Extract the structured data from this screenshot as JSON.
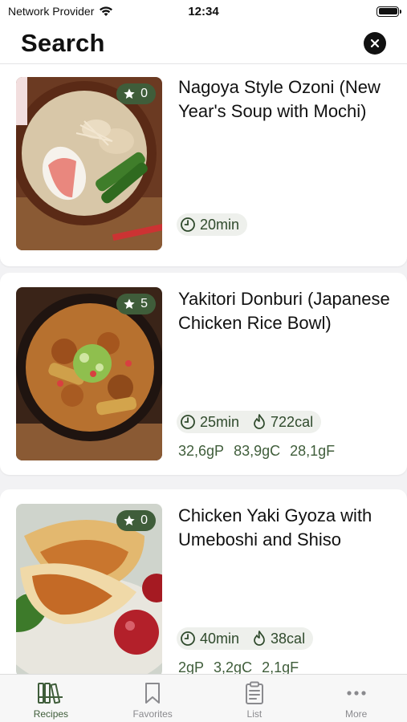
{
  "status_bar": {
    "carrier": "Network Provider",
    "time": "12:34"
  },
  "header": {
    "title": "Search"
  },
  "recipes": [
    {
      "title": "Nagoya Style Ozoni (New Year's Soup with Mochi)",
      "rating": "0",
      "time": "20min",
      "calories": "",
      "macros": []
    },
    {
      "title": "Yakitori Donburi (Japanese Chicken Rice Bowl)",
      "rating": "5",
      "time": "25min",
      "calories": "722cal",
      "macros": [
        "32,6gP",
        "83,9gC",
        "28,1gF"
      ]
    },
    {
      "title": "Chicken Yaki Gyoza with Umeboshi and Shiso",
      "rating": "0",
      "time": "40min",
      "calories": "38cal",
      "macros": [
        "2gP",
        "3,2gC",
        "2,1gF"
      ]
    }
  ],
  "tabs": [
    {
      "label": "Recipes",
      "icon": "books-icon",
      "active": true
    },
    {
      "label": "Favorites",
      "icon": "bookmark-icon",
      "active": false
    },
    {
      "label": "List",
      "icon": "clipboard-list-icon",
      "active": false
    },
    {
      "label": "More",
      "icon": "ellipsis-icon",
      "active": false
    }
  ],
  "colors": {
    "accent": "#3f5d3a",
    "chip_bg": "#eef0ec",
    "background": "#f2f2f4"
  }
}
